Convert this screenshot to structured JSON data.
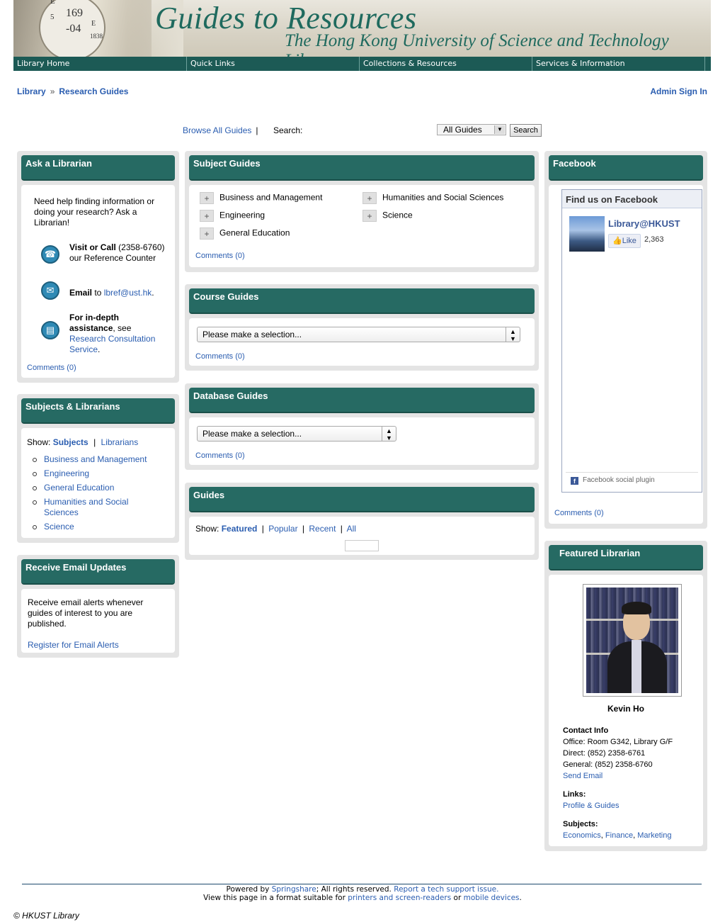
{
  "banner": {
    "title": "Guides to Resources",
    "subtitle": "The Hong Kong University of Science and Technology Library",
    "clock_digits": [
      "169",
      "-04",
      "E",
      "5",
      "E",
      "1838"
    ]
  },
  "nav": [
    "Library Home",
    "Quick Links",
    "Collections & Resources",
    "Services & Information"
  ],
  "breadcrumb": {
    "library": "Library",
    "sep": "»",
    "research_guides": "Research Guides"
  },
  "admin_sign_in": "Admin Sign In",
  "search_bar": {
    "browse_all": "Browse All Guides",
    "pipe": "|",
    "search_label": "Search:",
    "scope_value": "All Guides",
    "search_button": "Search"
  },
  "ask_librarian": {
    "title": "Ask a Librarian",
    "intro": "Need help finding information or doing your research? Ask a Librarian!",
    "visit_bold": "Visit or Call",
    "visit_rest": " (2358-6760) our Reference Counter",
    "email_bold": "Email",
    "email_to": " to ",
    "email_addr": "lbref@ust.hk",
    "email_end": ".",
    "indepth_bold": "For in-depth assistance",
    "indepth_see": ", see ",
    "indepth_link": "Research Consultation Service",
    "indepth_end": ".",
    "comments": "Comments (0)"
  },
  "subjects_librarians": {
    "title": "Subjects & Librarians",
    "show_label": "Show:",
    "show_subjects": "Subjects",
    "pipe": "|",
    "show_librarians": "Librarians",
    "items": [
      "Business and Management",
      "Engineering",
      "General Education",
      "Humanities and Social Sciences",
      "Science"
    ]
  },
  "email_updates": {
    "title": "Receive Email Updates",
    "text": "Receive email alerts whenever guides of interest to you are published.",
    "link": "Register for Email Alerts"
  },
  "subject_guides": {
    "title": "Subject Guides",
    "plus": "+",
    "left": [
      "Business and Management",
      "Engineering",
      "General Education"
    ],
    "right": [
      "Humanities and Social Sciences",
      "Science"
    ],
    "comments": "Comments (0)"
  },
  "course_guides": {
    "title": "Course Guides",
    "select_value": "Please make a selection...",
    "comments": "Comments (0)"
  },
  "database_guides": {
    "title": "Database Guides",
    "select_value": "Please make a selection...",
    "comments": "Comments (0)"
  },
  "guides": {
    "title": "Guides",
    "show_label": "Show:",
    "pipe": "|",
    "featured": "Featured",
    "popular": "Popular",
    "recent": "Recent",
    "all": "All"
  },
  "facebook": {
    "title": "Facebook",
    "find_us": "Find us on Facebook",
    "page_name": "Library@HKUST",
    "like": "Like",
    "like_count": "2,363",
    "plugin_label": "Facebook social plugin",
    "comments": "Comments (0)"
  },
  "featured_librarian": {
    "title": "Featured Librarian",
    "name": "Kevin Ho",
    "contact_heading": "Contact Info",
    "office": "Office: Room G342, Library G/F",
    "direct": "Direct: (852) 2358-6761",
    "general": "General: (852) 2358-6760",
    "send_email": "Send Email",
    "links_heading": "Links:",
    "profile_link": "Profile & Guides",
    "subjects_heading": "Subjects:",
    "subjects": [
      "Economics",
      "Finance",
      "Marketing"
    ],
    "comma": ","
  },
  "footer": {
    "powered_by": "Powered by ",
    "springshare": "Springshare",
    "rights": "; All rights reserved. ",
    "report": "Report a tech support issue.",
    "view_page": "View this page in a format suitable for ",
    "printers": "printers and screen-readers",
    "or": " or ",
    "mobile": "mobile devices",
    "period": ".",
    "copyright": "© HKUST Library"
  },
  "colors": {
    "header_green": "#266a63",
    "nav_green": "#1c5a55",
    "link_blue": "#2a5db0",
    "panel_gray": "#e4e4e4"
  }
}
